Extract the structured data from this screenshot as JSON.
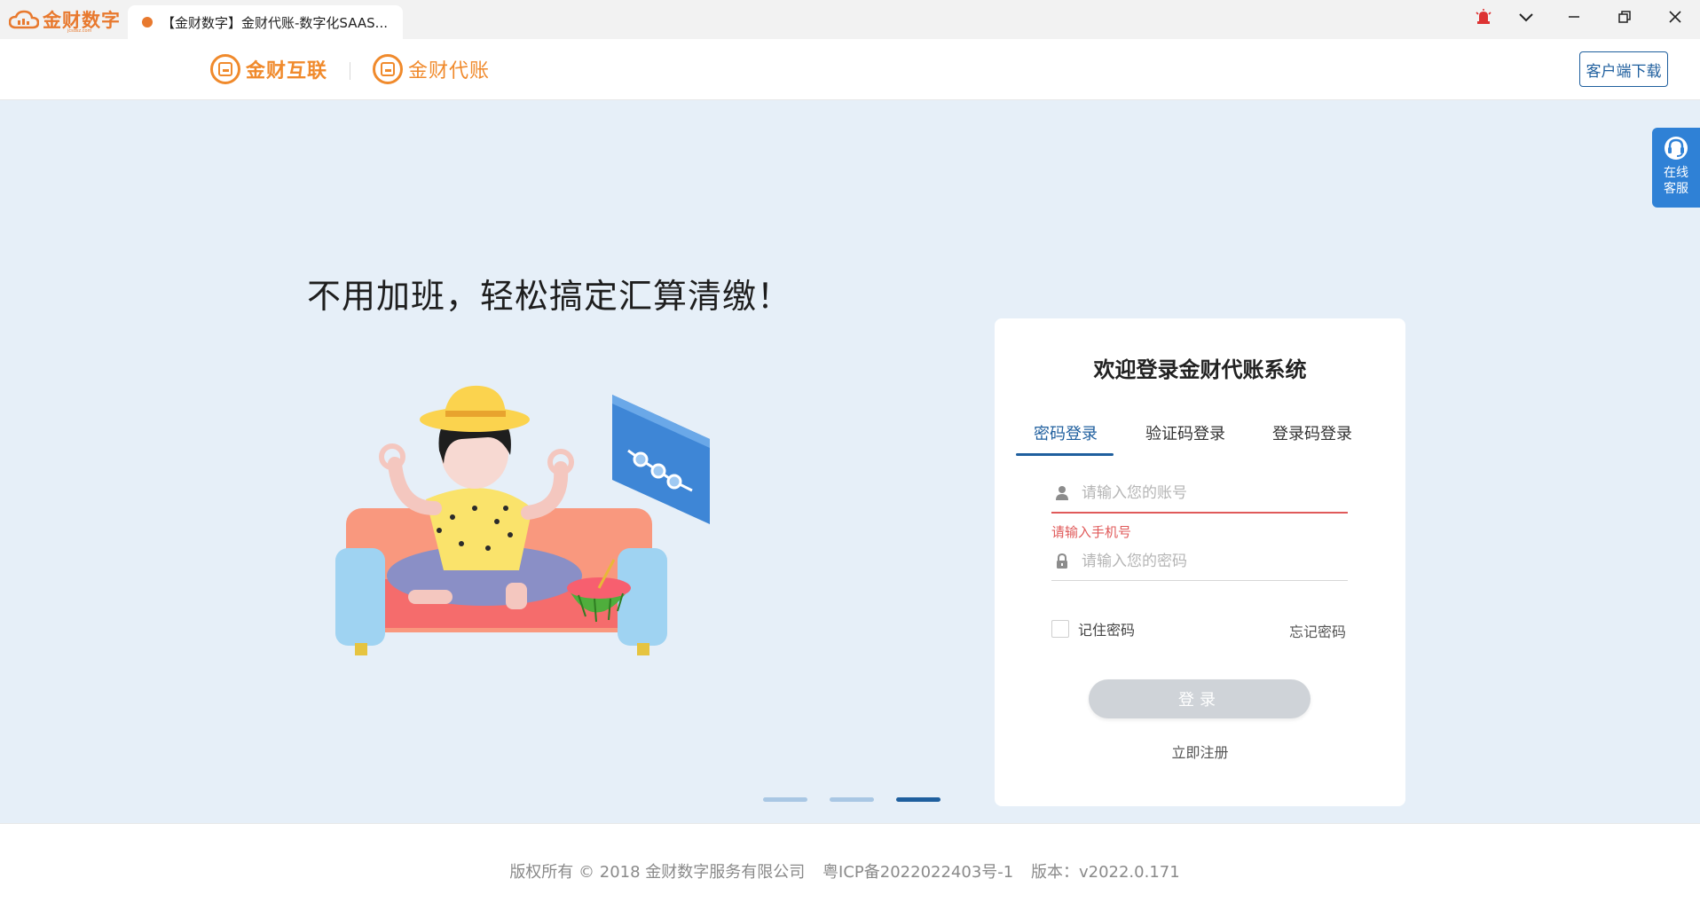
{
  "app": {
    "brand": "金财数字",
    "brand_sub": "jcsdsz.com"
  },
  "tab": {
    "title": "【金财数字】金财代账-数字化SAAS..."
  },
  "header": {
    "logo1": "金财互联",
    "logo2": "金财代账",
    "download": "客户端下载"
  },
  "hero": {
    "slogan": "不用加班，轻松搞定汇算清缴！",
    "carousel_total": 3,
    "carousel_active": 3
  },
  "service": {
    "label": "在线客服"
  },
  "login": {
    "title": "欢迎登录金财代账系统",
    "tabs": [
      "密码登录",
      "验证码登录",
      "登录码登录"
    ],
    "active_tab": 0,
    "account_placeholder": "请输入您的账号",
    "account_error": "请输入手机号",
    "password_placeholder": "请输入您的密码",
    "remember": "记住密码",
    "forgot": "忘记密码",
    "submit": "登录",
    "register": "立即注册"
  },
  "footer": {
    "copyright": "版权所有 © 2018 金财数字服务有限公司",
    "icp": "粤ICP备2022022403号-1",
    "version": "版本：v2022.0.171"
  },
  "colors": {
    "brand_orange": "#f08a2c",
    "primary_blue": "#1f5f9e",
    "error_red": "#e05a5a",
    "hero_bg": "#e6eff8"
  }
}
